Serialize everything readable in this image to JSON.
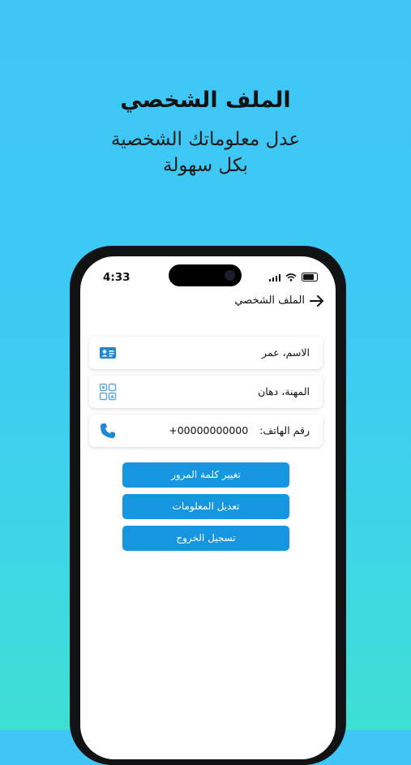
{
  "promo": {
    "title": "الملف الشخصي",
    "subtitle_line1": "عدل معلوماتك الشخصية",
    "subtitle_line2": "بكل سهولة"
  },
  "status_bar": {
    "time": "4:33"
  },
  "header": {
    "title": "الملف الشخصي",
    "back_icon": "arrow-right-icon"
  },
  "profile": {
    "name": "الاسم، عمر",
    "profession": "المهنة، دهان",
    "phone_label": "رقم الهاتف:",
    "phone_value": "+00000000000"
  },
  "actions": {
    "change_password": "تغيير كلمة المرور",
    "edit_info": "تعديل المعلومات",
    "logout": "تسجيل الخروج"
  },
  "colors": {
    "background_top": "#3fc6f6",
    "background_bottom": "#3fdfd3",
    "accent": "#1695e0"
  }
}
